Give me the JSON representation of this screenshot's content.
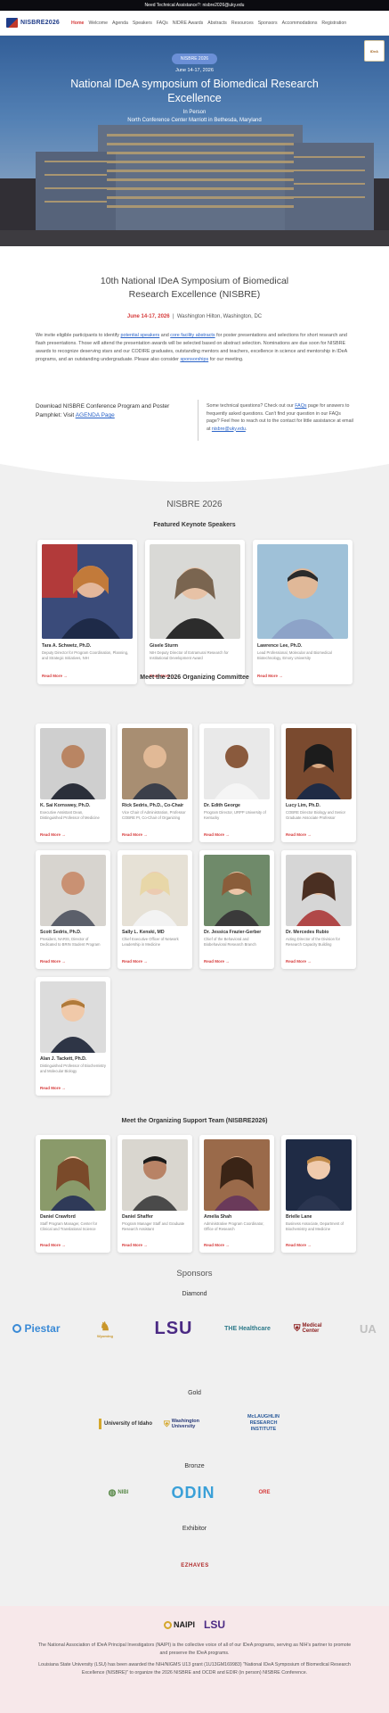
{
  "topbar": {
    "text": "Need Technical Assistance?: nisbre2026@uky.edu"
  },
  "brand": {
    "name": "NISBRE2026"
  },
  "nav": [
    {
      "label": "Home",
      "active": true
    },
    {
      "label": "Welcome"
    },
    {
      "label": "Agenda"
    },
    {
      "label": "Speakers"
    },
    {
      "label": "FAQs"
    },
    {
      "label": "NIDRE Awards"
    },
    {
      "label": "Abstracts"
    },
    {
      "label": "Resources"
    },
    {
      "label": "Sponsors"
    },
    {
      "label": "Accommodations"
    },
    {
      "label": "Registration"
    }
  ],
  "hero": {
    "badge": "NISBRE 2026",
    "date": "June 14-17, 2026",
    "title": "National IDeA symposium of Biomedical Research Excellence",
    "sub1": "In Person",
    "sub2": "North Conference Center Marriott in Bethesda, Maryland",
    "logo_text": "IDeA"
  },
  "intro": {
    "title": "10th National IDeA Symposium of Biomedical Research Excellence (NISBRE)",
    "date": "June 14-17, 2026",
    "sep": "|",
    "location": "Washington Hilton, Washington, DC",
    "para_a": "We invite eligible participants to identify ",
    "para_link1": "potential speakers",
    "para_b": " and ",
    "para_link2": "core facility abstracts",
    "para_c": " for poster presentations and selections for short research and flash presentations. Those will attend the presentation awards will be selected based on abstract selection. Nominations are due soon for NISBRE awards to recognize deserving stars and our CODIRE graduates, outstanding mentors and teachers, excellence in science and mentorship in IDeA programs, and an outstanding undergraduate. Please also consider ",
    "para_link3": "sponsorships",
    "para_d": " for our meeting.",
    "left_a": "Download NISBRE Conference Program and Poster Pamphlet: Visit ",
    "left_link": "AGENDA Page",
    "right_a": "Some technical questions? Check out our ",
    "right_link1": "FAQs",
    "right_b": " page for answers to frequently asked questions. Can't find your question in our FAQs page? Feel free to reach out to the contact for little assistance at email at ",
    "right_link2": "nisbre@uky.edu",
    "right_c": "."
  },
  "section_heading": "NISBRE 2026",
  "keynote": {
    "heading": "Featured Keynote Speakers",
    "read_more": "Read More →",
    "people": [
      {
        "name": "Tara A. Schwetz, Ph.D.",
        "desc": "Deputy Director for Program Coordination, Planning, and Strategic Initiatives, NIH"
      },
      {
        "name": "Gisele Sturm",
        "desc": "NIH Deputy Director of Extramural Research for Institutional Development Award"
      },
      {
        "name": "Lawrence Lee, Ph.D.",
        "desc": "Lead Professional, Molecular and Biomedical Biotechnology, Emory University"
      }
    ]
  },
  "committee": {
    "heading": "Meet the 2026 Organizing Committee",
    "read_more": "Read More →",
    "people": [
      {
        "name": "K. Sai Kornswey, Ph.D.",
        "desc": "Executive Assistant Dean, Distinguished Professor of Medicine"
      },
      {
        "name": "Rick Sedris, Ph.D., Co-Chair",
        "desc": "Vice Chair of Administration, Professor COBRE PI, Co-Chair of Organizing"
      },
      {
        "name": "Dr. Edith George",
        "desc": "Program Director, URPP University of Kentucky"
      },
      {
        "name": "Lucy Lim, Ph.D.",
        "desc": "COBRE Director Biology and Senior Graduate Associate Professor"
      },
      {
        "name": "Scott Sedris, Ph.D.",
        "desc": "President, NARIS, Director of Dedicated to BRIN Student Program"
      },
      {
        "name": "Sally L. Kenski, MD",
        "desc": "Chief Executive Officer of Network Leadership in Medicine"
      },
      {
        "name": "Dr. Jessica Frazier-Gerber",
        "desc": "Chief of the Behavioral and Biobehavioral Research Branch"
      },
      {
        "name": "Dr. Mercedes Rubio",
        "desc": "Acting Director of the Division for Research Capacity Building"
      },
      {
        "name": "Alan J. Tackett, Ph.D.",
        "desc": "Distinguished Professor of Biochemistry and Molecular Biology"
      }
    ]
  },
  "support": {
    "heading": "Meet the Organizing Support Team (NISBRE2026)",
    "read_more": "Read More →",
    "people": [
      {
        "name": "Daniel Crawford",
        "desc": "Staff Program Manager, Center for Clinical and Translational Science"
      },
      {
        "name": "Daniel Shaffer",
        "desc": "Program Manager Staff and Graduate Research Assistant"
      },
      {
        "name": "Amelia Shah",
        "desc": "Administrative Program Coordinator, Office of Research"
      },
      {
        "name": "Brielle Lane",
        "desc": "Business Associate, Department of Biochemistry and Medicine"
      }
    ]
  },
  "sponsors": {
    "heading": "Sponsors",
    "tiers": {
      "diamond": "Diamond",
      "gold": "Gold",
      "bronze": "Bronze",
      "exhibitor": "Exhibitor"
    },
    "diamond_logos": [
      "Piestar",
      "Wyoming",
      "LSU",
      "THE Healthcare",
      "Medical Center",
      "UA"
    ],
    "gold_logos": [
      "University of Idaho",
      "Washington University",
      "McLAUGHLIN RESEARCH INSTITUTE"
    ],
    "bronze_logos": [
      "NIBI",
      "ODIN",
      "ORE"
    ],
    "exhibitor_logos": [
      "EZHAVES"
    ]
  },
  "footer": {
    "logo1": "NAIPI",
    "logo2": "LSU",
    "text1": "The National Association of IDeA Principal Investigators (NAIPI) is the collective voice of all of our IDeA programs, serving as NIH's partner to promote and preserve the IDeA programs.",
    "text2": "Louisiana State University (LSU) has been awarded the NIH/NIGMS U13 grant (1U13GM169983) \"National IDeA Symposium of Biomedical Research Excellence (NISBRE)\" to organize the 2026 NISBRE and OCDR and EDIR (in person) NISBRE Conference."
  },
  "colors": {
    "accent": "#d63b3b",
    "brand": "#1f3c88",
    "link": "#2a63c8"
  }
}
